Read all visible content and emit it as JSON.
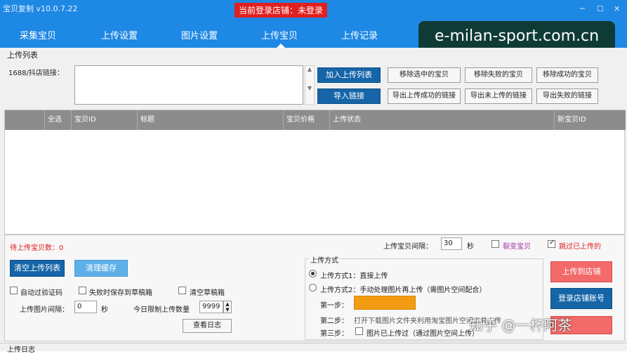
{
  "window": {
    "title": "宝贝复制 v10.0.7.22",
    "login_status": "当前登录店铺：未登录",
    "controls": [
      "─",
      "☐",
      "✕"
    ]
  },
  "nav": {
    "tabs": [
      {
        "label": "采集宝贝"
      },
      {
        "label": "上传设置"
      },
      {
        "label": "图片设置"
      },
      {
        "label": "上传宝贝",
        "active": true
      },
      {
        "label": "上传记录"
      }
    ]
  },
  "watermark": "e-milan-sport.com.cn",
  "upload_list": {
    "section_title": "上传列表",
    "link_label": "1688/抖店链接：",
    "link_value": "",
    "buttons": {
      "add": "加入上传列表",
      "import": "导入链接",
      "remove_selected": "移除选中的宝贝",
      "remove_failed": "移除失败的宝贝",
      "remove_success": "移除成功的宝贝",
      "export_success": "导出上传成功的链接",
      "export_not_uploaded": "导出未上传的链接",
      "export_failed": "导出失败的链接"
    },
    "columns": [
      "全选",
      "宝贝ID",
      "标题",
      "宝贝价格",
      "上传状态",
      "新宝贝ID"
    ]
  },
  "bottom": {
    "pending_label": "待上传宝贝数：0",
    "interval_label": "上传宝贝间隔：",
    "interval_value": "30",
    "interval_unit": "秒",
    "split_item": "裂变宝贝",
    "skip_uploaded": "跳过已上传的",
    "clear_list": "清空上传列表",
    "clear_cache": "清理缓存",
    "auto_captcha": "自动过验证码",
    "save_draft": "失败时保存到草稿箱",
    "clear_draft": "清空草稿箱",
    "img_interval_label": "上传图片间隔：",
    "img_interval_value": "0",
    "img_interval_unit": "秒",
    "daily_limit_label": "今日限制上传数量",
    "daily_limit_value": "9999",
    "view_log": "查看日志",
    "method": {
      "title": "上传方式",
      "opt1": "上传方式1：直接上传",
      "opt2": "上传方式2：手动处理图片再上传（需图片空间配合）",
      "step1": "第一步：",
      "step2": "第二步：",
      "step2_text": "打开下载图片文件夹利用淘宝图片空间工具上传",
      "step3": "第三步：",
      "step3_text": "图片已上传过（通过图片空间上传）"
    },
    "upload_shop": "上传到店铺",
    "login_shop": "登录店铺账号",
    "overlay_logo": "知乎 @一杯阿茶",
    "log_title": "上传日志"
  }
}
